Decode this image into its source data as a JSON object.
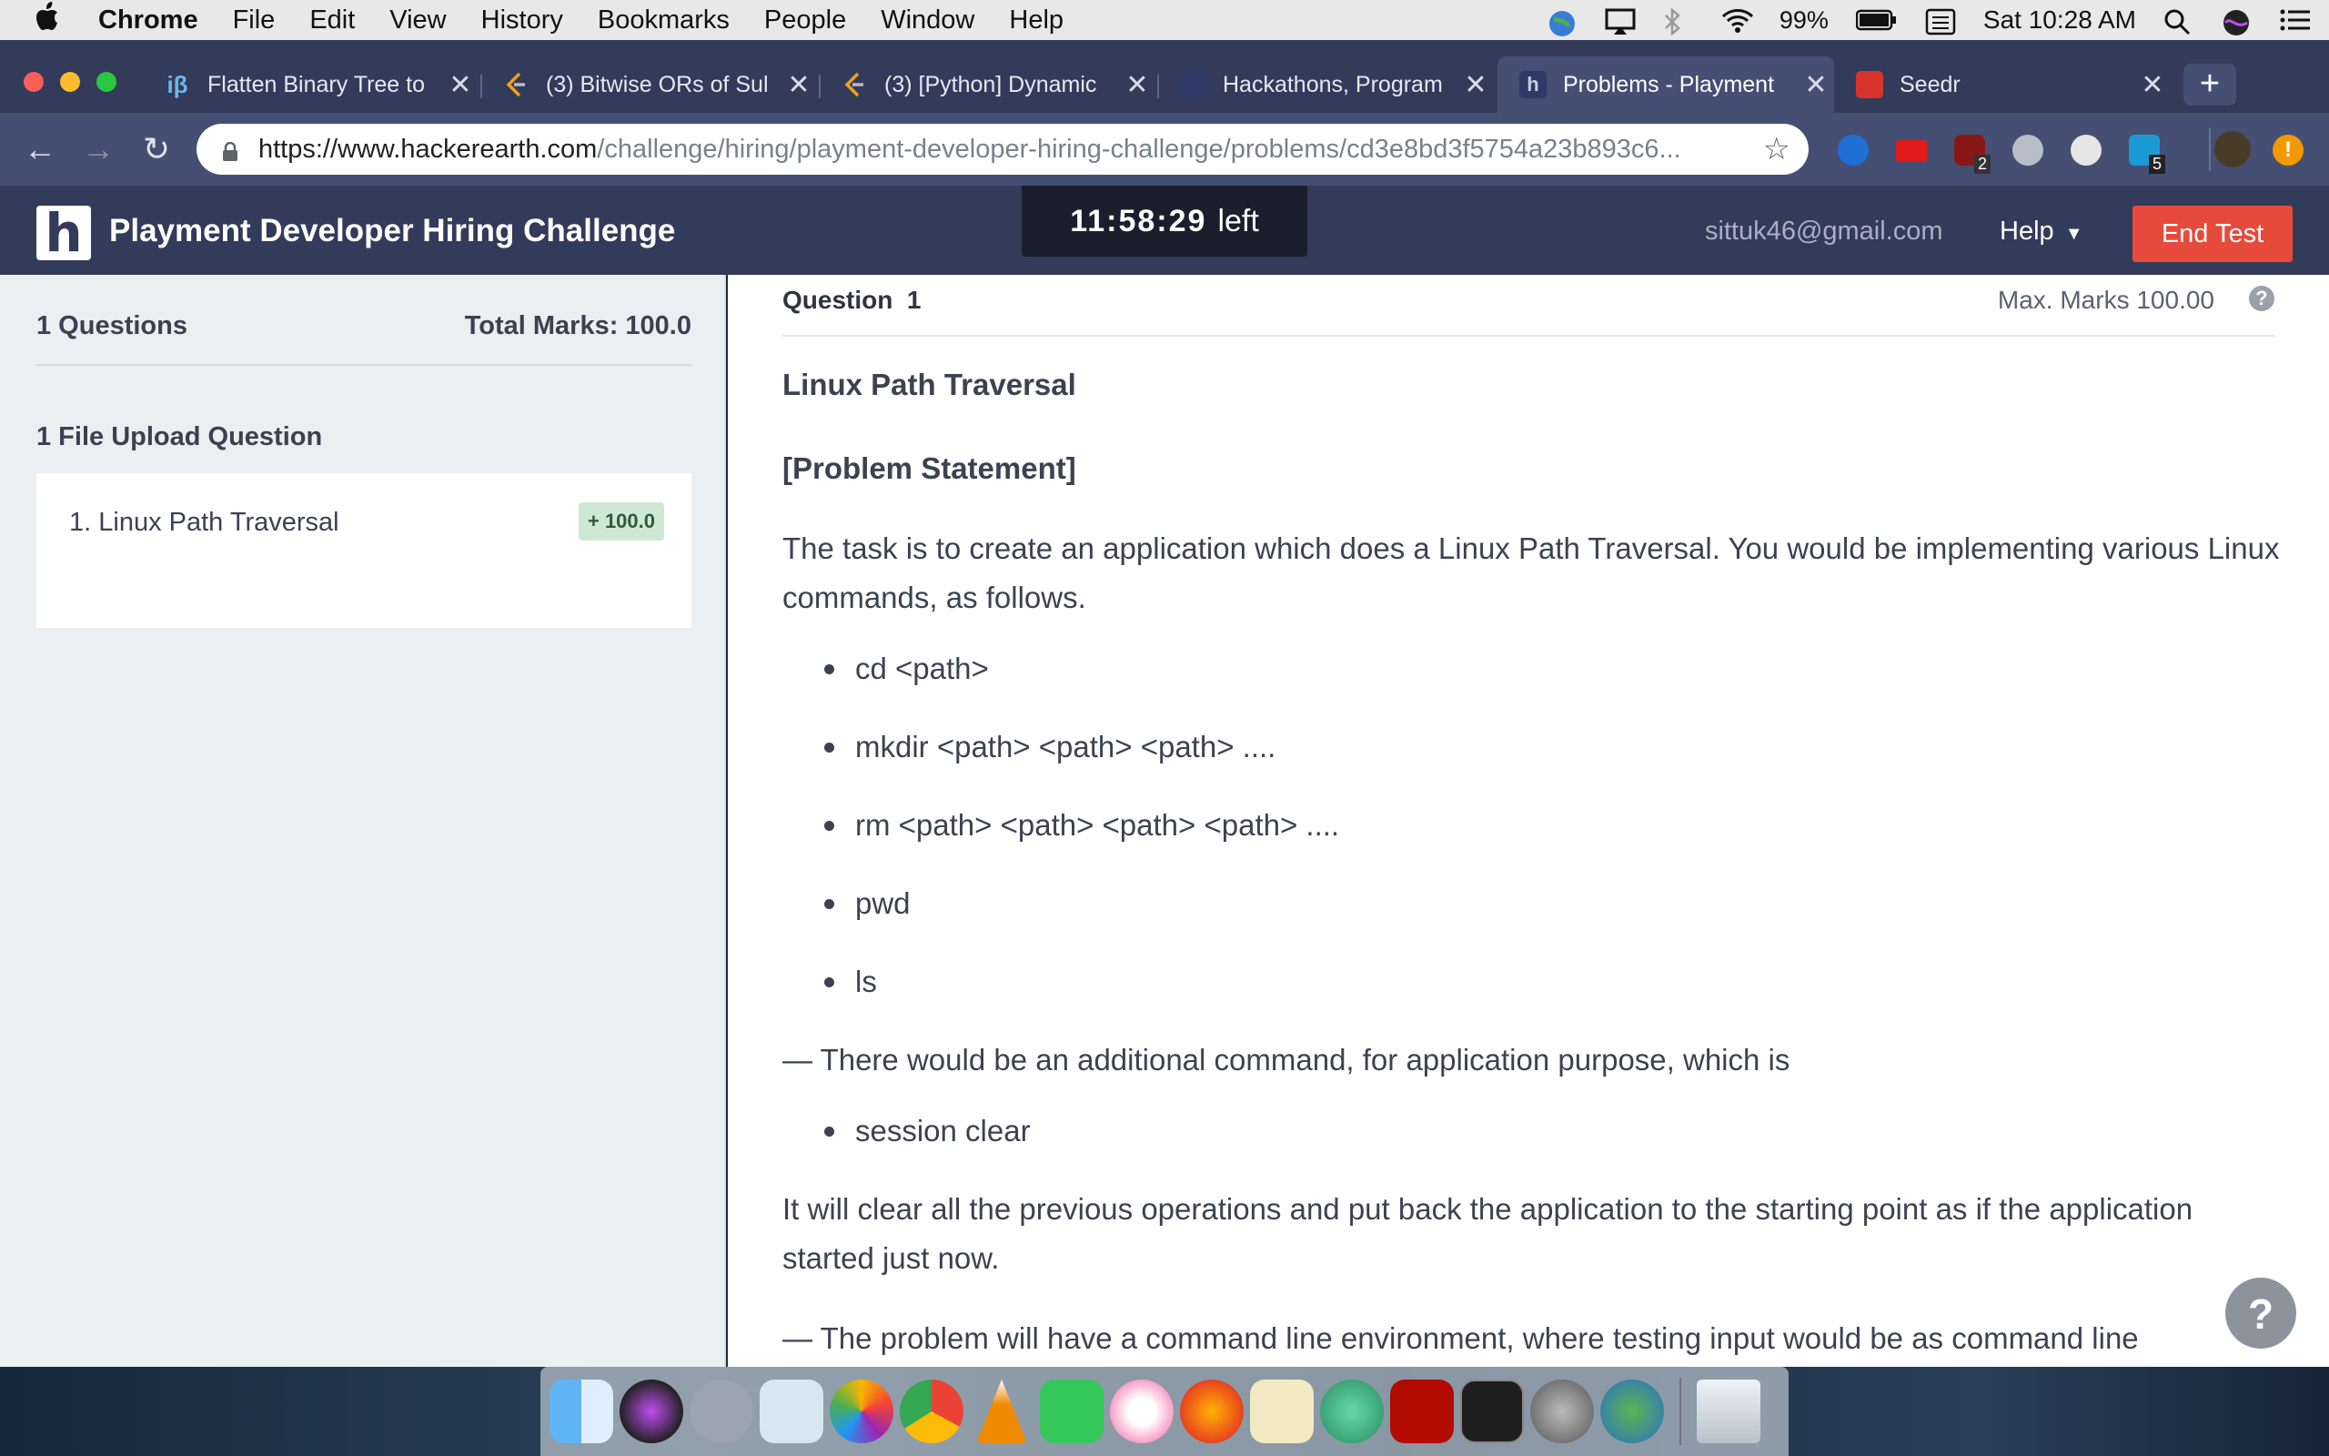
{
  "menubar": {
    "app": "Chrome",
    "items": [
      "File",
      "Edit",
      "View",
      "History",
      "Bookmarks",
      "People",
      "Window",
      "Help"
    ],
    "battery": "99%",
    "clock": "Sat 10:28 AM"
  },
  "tabs": [
    {
      "favicon": "iβ",
      "title": "Flatten Binary Tree to"
    },
    {
      "favicon": "",
      "title": "(3) Bitwise ORs of Sul"
    },
    {
      "favicon": "",
      "title": "(3) [Python] Dynamic"
    },
    {
      "favicon": "",
      "title": "Hackathons, Program"
    },
    {
      "favicon": "h",
      "title": "Problems - Playment"
    },
    {
      "favicon": "",
      "title": "Seedr"
    }
  ],
  "address": {
    "host": "https://www.hackerearth.com",
    "path": "/challenge/hiring/playment-developer-hiring-challenge/problems/cd3e8bd3f5754a23b893c6..."
  },
  "extensions": {
    "ublock_count": "2",
    "ext_count": "5"
  },
  "header": {
    "logo": "h",
    "title": "Playment Developer Hiring Challenge",
    "timer": "11:58:29",
    "timer_suffix": "left",
    "email": "sittuk46@gmail.com",
    "help": "Help",
    "end_test": "End Test"
  },
  "sidebar": {
    "questions_count": "1 Questions",
    "total_marks": "Total Marks: 100.0",
    "section": "1 File Upload Question",
    "question_label": "1. Linux Path Traversal",
    "question_badge": "+ 100.0"
  },
  "question": {
    "label": "Question",
    "number": "1",
    "max_marks": "Max. Marks 100.00",
    "title": "Linux Path Traversal",
    "statement_heading": "[Problem Statement]",
    "intro": "The task is to create an application which does a Linux Path Traversal. You would be implementing various Linux commands, as follows.",
    "commands": [
      "cd <path>",
      "mkdir <path> <path> <path> ....",
      "rm <path> <path> <path> <path> ....",
      "pwd",
      "ls"
    ],
    "additional": "— There would be an additional command, for application purpose, which is",
    "extra_commands": [
      "session clear"
    ],
    "session_note": "It will clear all the previous operations and put back the application to the starting point as if the application started just now.",
    "environment_note": "— The problem will have a command line environment, where testing input would be as command line"
  },
  "help_fab": "?",
  "colors": {
    "header_bg": "#323b5a",
    "end_test": "#e64a3b",
    "badge_bg": "#cfe8d3"
  }
}
